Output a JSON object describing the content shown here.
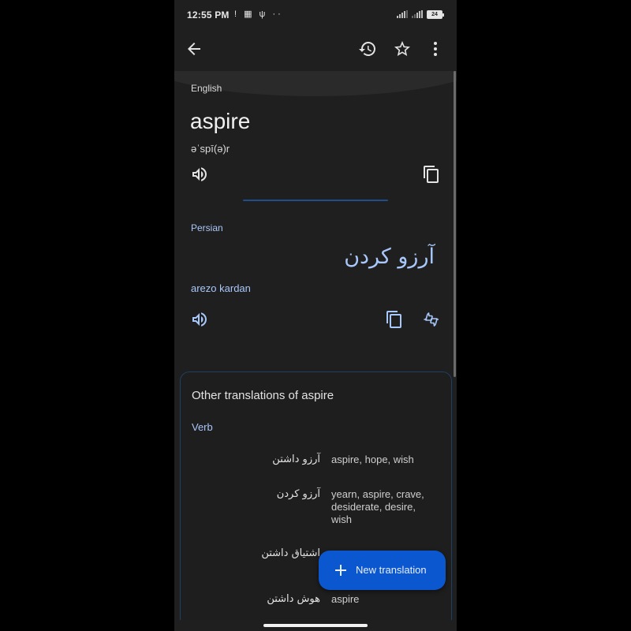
{
  "status_bar": {
    "time": "12:55 PM",
    "left_icons": "! ▦ ψ ··",
    "battery": "24"
  },
  "app_bar": {
    "back_icon": "arrow-back-icon",
    "history_icon": "history-icon",
    "star_icon": "star-outline-icon",
    "more_icon": "more-vert-icon"
  },
  "source": {
    "language": "English",
    "word": "aspire",
    "phonetic": "əˈspī(ə)r"
  },
  "target": {
    "language": "Persian",
    "translation": "آرزو کردن",
    "transliteration": "arezo kardan"
  },
  "other_translations": {
    "title": "Other translations of aspire",
    "part_of_speech": "Verb",
    "rows": [
      {
        "persian": "آرزو داشتن",
        "english": "aspire, hope, wish"
      },
      {
        "persian": "آرزو کردن",
        "english": "yearn, aspire, crave, desiderate, desire, wish"
      },
      {
        "persian": "اشتیاق داشتن",
        "english": ""
      },
      {
        "persian": "هوش داشتن",
        "english": "aspire"
      }
    ]
  },
  "fab": {
    "label": "New translation"
  },
  "colors": {
    "background": "#1f1f1f",
    "accent_text": "#a8c7fa",
    "fab": "#0b57d0",
    "card_border": "#1f3f66"
  }
}
